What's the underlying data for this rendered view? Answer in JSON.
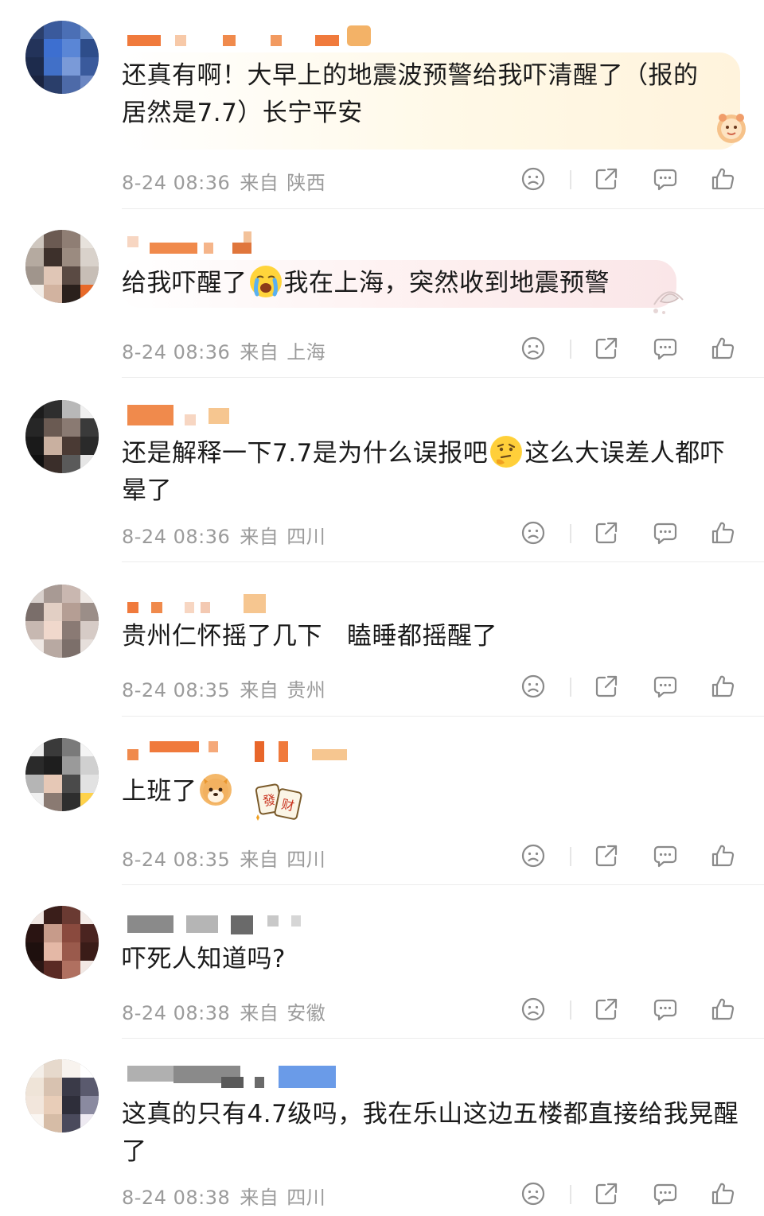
{
  "comments": [
    {
      "text": "还真有啊！大早上的地震波预警给我吓清醒了（报的居然是7.7）长宁平安",
      "date": "8-24 08:36",
      "from": "来自",
      "region": "陕西"
    },
    {
      "text_before": "给我吓醒了",
      "text_after": "我在上海，突然收到地震预警",
      "date": "8-24 08:36",
      "from": "来自",
      "region": "上海"
    },
    {
      "text_before": "还是解释一下7.7是为什么误报吧",
      "text_after": "这么大误差人都吓晕了",
      "date": "8-24 08:36",
      "from": "来自",
      "region": "四川"
    },
    {
      "text": "贵州仁怀摇了几下   瞌睡都摇醒了",
      "date": "8-24 08:35",
      "from": "来自",
      "region": "贵州"
    },
    {
      "text": "上班了",
      "sticker_chars": [
        "發",
        "财"
      ],
      "date": "8-24 08:35",
      "from": "来自",
      "region": "四川"
    },
    {
      "text": "吓死人知道吗?",
      "date": "8-24 08:38",
      "from": "来自",
      "region": "安徽"
    },
    {
      "text": "这真的只有4.7级吗，我在乐山这边五楼都直接给我晃醒了",
      "date": "8-24 08:38",
      "from": "来自",
      "region": "四川"
    }
  ],
  "actions": [
    "dislike-icon",
    "share-icon",
    "comment-icon",
    "like-icon"
  ],
  "colors": {
    "meta_gray": "#9b9b9b",
    "icon_gray": "#8a8a8a",
    "name_orange": "#f07a3c",
    "name_gray": "#9a9a9a",
    "name_blue": "#6a9be8"
  }
}
